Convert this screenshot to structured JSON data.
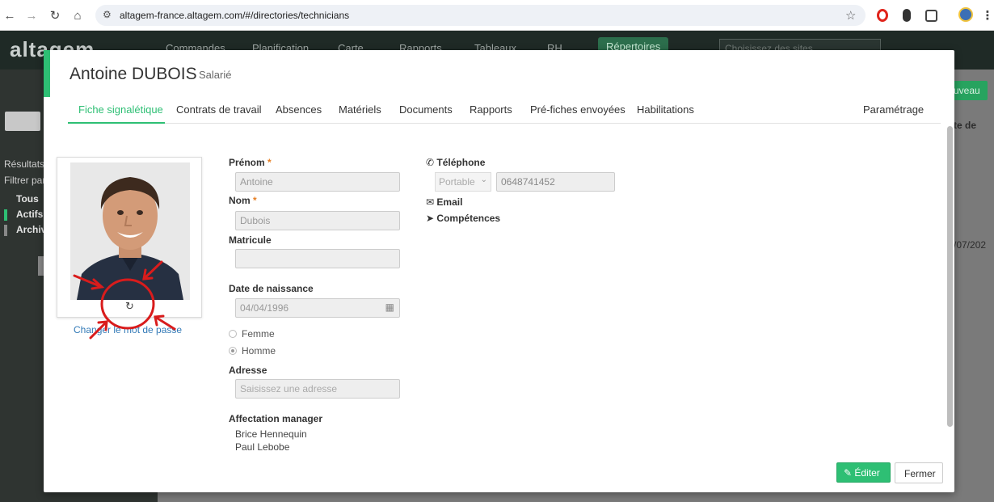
{
  "browser": {
    "url": "altagem-france.altagem.com/#/directories/technicians"
  },
  "app_nav": {
    "logo": "altagem",
    "items": [
      "Commandes",
      "Planification",
      "Carte",
      "Rapports",
      "Tableaux",
      "RH",
      "Répertoires"
    ],
    "site_select_placeholder": "Choisissez des sites"
  },
  "left_panel": {
    "results_label": "Résultats",
    "filter_label": "Filtrer par",
    "filters": [
      "Tous",
      "Actifs",
      "Archiv"
    ]
  },
  "background": {
    "new_button": "uveau",
    "column_header": "te de",
    "date_cell": "/07/202"
  },
  "modal": {
    "name": "Antoine DUBOIS",
    "role": "Salarié",
    "tabs": [
      "Fiche signalétique",
      "Contrats de travail",
      "Absences",
      "Matériels",
      "Documents",
      "Rapports",
      "Pré-fiches envoyées",
      "Habilitations"
    ],
    "settings_tab": "Paramétrage",
    "change_password": "Changer le mot de passe",
    "form": {
      "first_name_label": "Prénom",
      "first_name_value": "Antoine",
      "last_name_label": "Nom",
      "last_name_value": "Dubois",
      "employee_id_label": "Matricule",
      "employee_id_value": "",
      "birth_date_label": "Date de naissance",
      "birth_date_value": "04/04/1996",
      "gender_female": "Femme",
      "gender_male": "Homme",
      "address_label": "Adresse",
      "address_placeholder": "Saisissez une adresse",
      "manager_label": "Affectation manager",
      "managers": [
        "Brice Hennequin",
        "Paul Lebobe"
      ],
      "phone_label": "Téléphone",
      "phone_type": "Portable",
      "phone_value": "0648741452",
      "email_label": "Email",
      "skills_label": "Compétences"
    },
    "edit_button": "Éditer",
    "close_button": "Fermer"
  },
  "colors": {
    "accent": "#2ebf74",
    "link": "#337ab7",
    "annotation": "#d91c1c"
  }
}
